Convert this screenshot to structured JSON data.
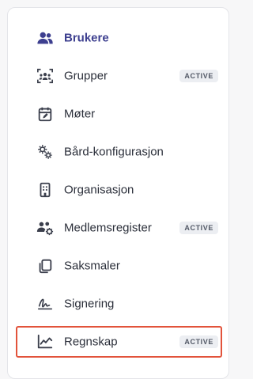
{
  "nav": {
    "items": [
      {
        "label": "Brukere",
        "icon": "users-icon",
        "badge": "",
        "selected": true
      },
      {
        "label": "Grupper",
        "icon": "group-scan-icon",
        "badge": "ACTIVE"
      },
      {
        "label": "Møter",
        "icon": "calendar-edit-icon",
        "badge": ""
      },
      {
        "label": "Bård-konfigurasjon",
        "icon": "gears-icon",
        "badge": ""
      },
      {
        "label": "Organisasjon",
        "icon": "building-icon",
        "badge": ""
      },
      {
        "label": "Medlemsregister",
        "icon": "users-cog-icon",
        "badge": "ACTIVE"
      },
      {
        "label": "Saksmaler",
        "icon": "copy-icon",
        "badge": ""
      },
      {
        "label": "Signering",
        "icon": "signature-icon",
        "badge": ""
      },
      {
        "label": "Regnskap",
        "icon": "line-chart-icon",
        "badge": "ACTIVE",
        "focused": true
      }
    ]
  },
  "colors": {
    "selected_text": "#3d3f8f",
    "text": "#2b2f3a",
    "icon": "#3b3f4c",
    "focus_border": "#e2533b",
    "badge_bg": "#eceef2"
  }
}
